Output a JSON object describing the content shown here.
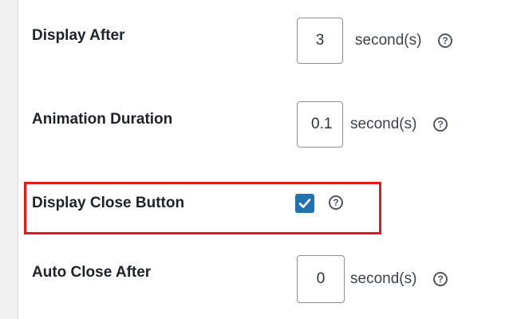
{
  "settings": {
    "display_after": {
      "label": "Display After",
      "value": "3",
      "unit": "second(s)",
      "help": "?"
    },
    "animation_duration": {
      "label": "Animation Duration",
      "value": "0.1",
      "unit": "second(s)",
      "help": "?"
    },
    "display_close_button": {
      "label": "Display Close Button",
      "checked": true,
      "help": "?"
    },
    "auto_close_after": {
      "label": "Auto Close After",
      "value": "0",
      "unit": "second(s)",
      "help": "?"
    }
  },
  "colors": {
    "checkbox": "#2271b1",
    "highlight": "#e11b1b"
  }
}
